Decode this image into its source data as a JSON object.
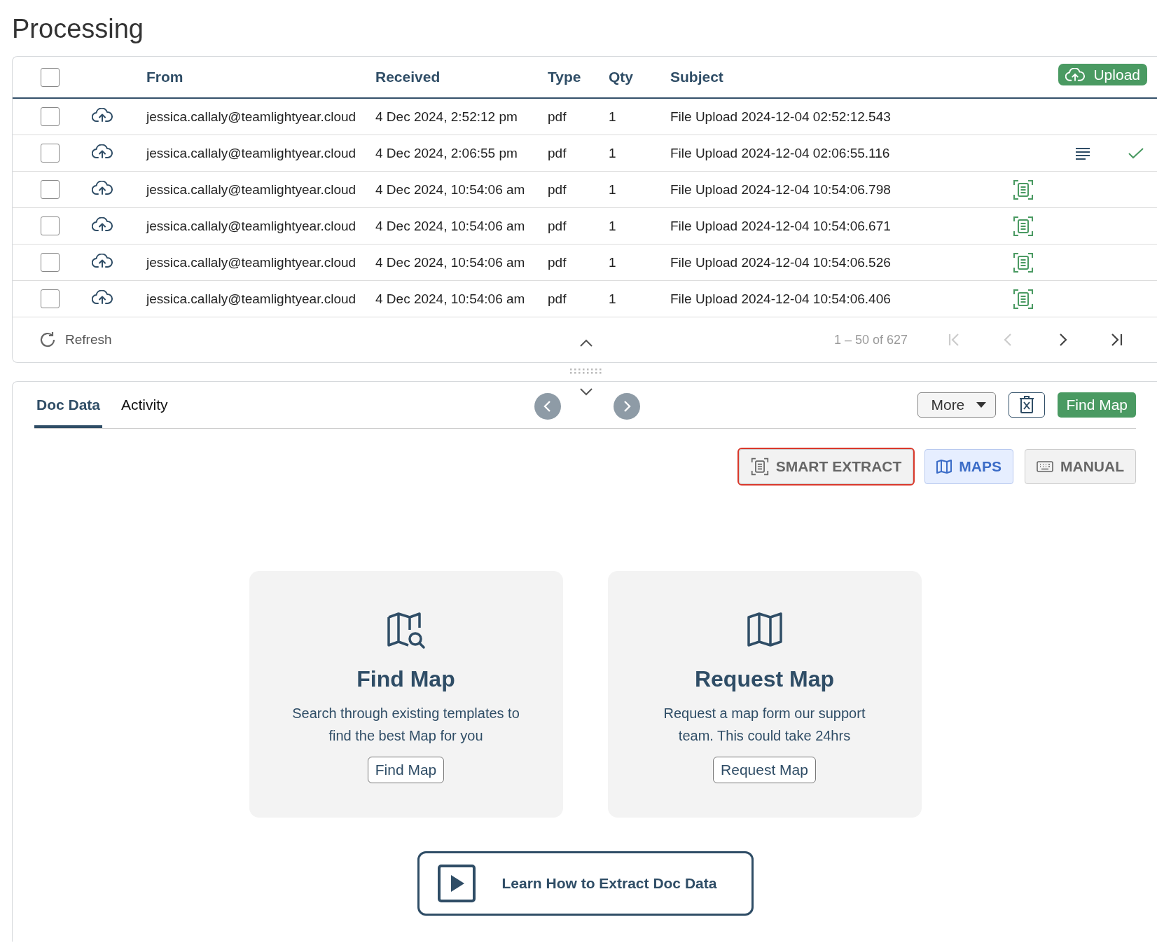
{
  "page": {
    "title": "Processing"
  },
  "table": {
    "select_all": {
      "checked": false
    },
    "columns": [
      "From",
      "Received",
      "Type",
      "Qty",
      "Subject"
    ],
    "upload_button": "Upload",
    "rows": [
      {
        "checked": false,
        "from": "jessica.callaly@teamlightyear.cloud",
        "received": "4 Dec 2024, 2:52:12 pm",
        "type": "pdf",
        "qty": "1",
        "subject": "File Upload 2024-12-04 02:52:12.543",
        "scan_ready": false,
        "has_text": false,
        "done": false
      },
      {
        "checked": false,
        "from": "jessica.callaly@teamlightyear.cloud",
        "received": "4 Dec 2024, 2:06:55 pm",
        "type": "pdf",
        "qty": "1",
        "subject": "File Upload 2024-12-04 02:06:55.116",
        "scan_ready": false,
        "has_text": true,
        "done": true
      },
      {
        "checked": false,
        "from": "jessica.callaly@teamlightyear.cloud",
        "received": "4 Dec 2024, 10:54:06 am",
        "type": "pdf",
        "qty": "1",
        "subject": "File Upload 2024-12-04 10:54:06.798",
        "scan_ready": true,
        "has_text": false,
        "done": false
      },
      {
        "checked": false,
        "from": "jessica.callaly@teamlightyear.cloud",
        "received": "4 Dec 2024, 10:54:06 am",
        "type": "pdf",
        "qty": "1",
        "subject": "File Upload 2024-12-04 10:54:06.671",
        "scan_ready": true,
        "has_text": false,
        "done": false
      },
      {
        "checked": false,
        "from": "jessica.callaly@teamlightyear.cloud",
        "received": "4 Dec 2024, 10:54:06 am",
        "type": "pdf",
        "qty": "1",
        "subject": "File Upload 2024-12-04 10:54:06.526",
        "scan_ready": true,
        "has_text": false,
        "done": false
      },
      {
        "checked": false,
        "from": "jessica.callaly@teamlightyear.cloud",
        "received": "4 Dec 2024, 10:54:06 am",
        "type": "pdf",
        "qty": "1",
        "subject": "File Upload 2024-12-04 10:54:06.406",
        "scan_ready": true,
        "has_text": false,
        "done": false
      }
    ],
    "footer": {
      "refresh": "Refresh",
      "range": "1 – 50 of 627",
      "pager": [
        {
          "kind": "first",
          "disabled": true
        },
        {
          "kind": "prev",
          "disabled": true
        },
        {
          "kind": "next",
          "disabled": false
        },
        {
          "kind": "last",
          "disabled": false
        }
      ]
    }
  },
  "doc_panel": {
    "tabs": [
      {
        "label": "Doc Data",
        "selected": true
      },
      {
        "label": "Activity",
        "selected": false
      }
    ],
    "more_button": "More",
    "find_map_button": "Find Map",
    "modes": [
      {
        "label": "SMART EXTRACT",
        "kind": "smart-extract",
        "selected": false,
        "highlighted": true
      },
      {
        "label": "MAPS",
        "kind": "maps",
        "selected": true,
        "highlighted": false
      },
      {
        "label": "MANUAL",
        "kind": "manual",
        "selected": false,
        "highlighted": false
      }
    ],
    "cards": [
      {
        "kind": "find",
        "title": "Find Map",
        "description": "Search through existing templates to find the best Map for you",
        "button": "Find Map"
      },
      {
        "kind": "request",
        "title": "Request Map",
        "description": "Request a map form our support team. This could take 24hrs",
        "button": "Request Map"
      }
    ],
    "learn_button": "Learn How to Extract Doc Data"
  }
}
